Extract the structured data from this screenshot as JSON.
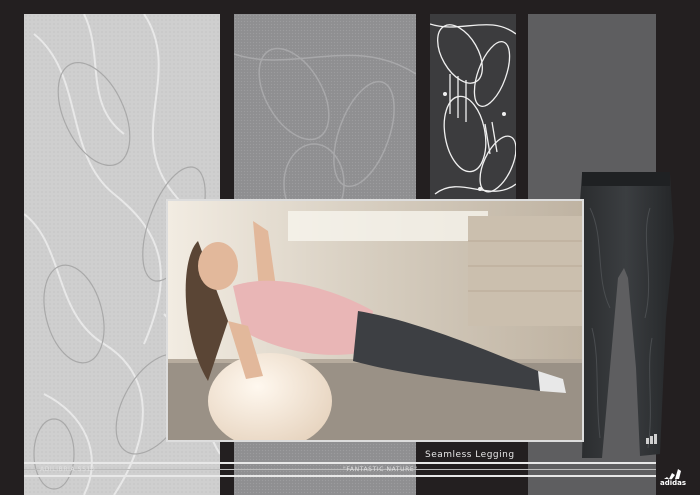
{
  "photo": {
    "caption": "Seamless Legging"
  },
  "footer": {
    "left_text": "ADILIBRIA SS10",
    "center_text": "\"FANTASTIC NATURE\"",
    "brand": "adidas"
  }
}
